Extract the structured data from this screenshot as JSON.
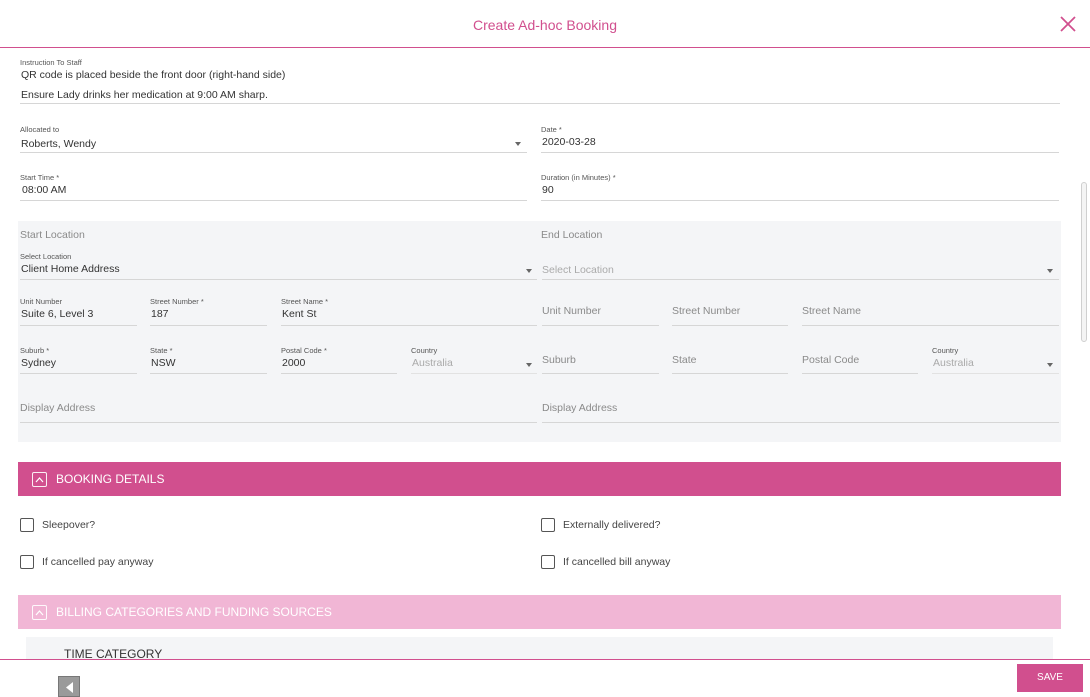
{
  "dialog": {
    "title": "Create Ad-hoc Booking"
  },
  "instructions": {
    "label": "Instruction To Staff",
    "line1": "QR code is placed beside the front door (right-hand side)",
    "line2": "Ensure Lady drinks her medication at 9:00 AM sharp."
  },
  "allocated_to": {
    "label": "Allocated to",
    "value": "Roberts, Wendy"
  },
  "date": {
    "label": "Date *",
    "value": "2020-03-28"
  },
  "start_time": {
    "label": "Start Time *",
    "value": "08:00 AM"
  },
  "duration": {
    "label": "Duration (in Minutes) *",
    "value": "90"
  },
  "start_location": {
    "heading": "Start Location",
    "select": {
      "label": "Select Location",
      "value": "Client Home Address"
    },
    "unit_number": {
      "label": "Unit Number",
      "value": "Suite 6, Level 3"
    },
    "street_number": {
      "label": "Street Number *",
      "value": "187"
    },
    "street_name": {
      "label": "Street Name *",
      "value": "Kent St"
    },
    "suburb": {
      "label": "Suburb *",
      "value": "Sydney"
    },
    "state": {
      "label": "State *",
      "value": "NSW"
    },
    "postal_code": {
      "label": "Postal Code *",
      "value": "2000"
    },
    "country": {
      "label": "Country",
      "value": "Australia"
    },
    "display_address": {
      "placeholder": "Display Address"
    }
  },
  "end_location": {
    "heading": "End Location",
    "select": {
      "placeholder": "Select Location"
    },
    "unit_number": {
      "placeholder": "Unit Number"
    },
    "street_number": {
      "placeholder": "Street Number"
    },
    "street_name": {
      "placeholder": "Street Name"
    },
    "suburb": {
      "placeholder": "Suburb"
    },
    "state": {
      "placeholder": "State"
    },
    "postal_code": {
      "placeholder": "Postal Code"
    },
    "country": {
      "label": "Country",
      "value": "Australia"
    },
    "display_address": {
      "placeholder": "Display Address"
    }
  },
  "booking_details": {
    "title": "BOOKING DETAILS",
    "color": "#d14f8e",
    "checkboxes": {
      "sleepover": "Sleepover?",
      "externally_delivered": "Externally delivered?",
      "cancel_pay": "If cancelled pay anyway",
      "cancel_bill": "If cancelled bill anyway"
    }
  },
  "billing": {
    "title": "BILLING CATEGORIES AND FUNDING SOURCES",
    "color": "#f1b6d5",
    "time_category": "TIME CATEGORY"
  },
  "footer": {
    "save_label": "SAVE"
  },
  "colors": {
    "accent": "#d14f8e",
    "accent_light": "#f1b6d5",
    "panel": "#f4f5f7"
  }
}
